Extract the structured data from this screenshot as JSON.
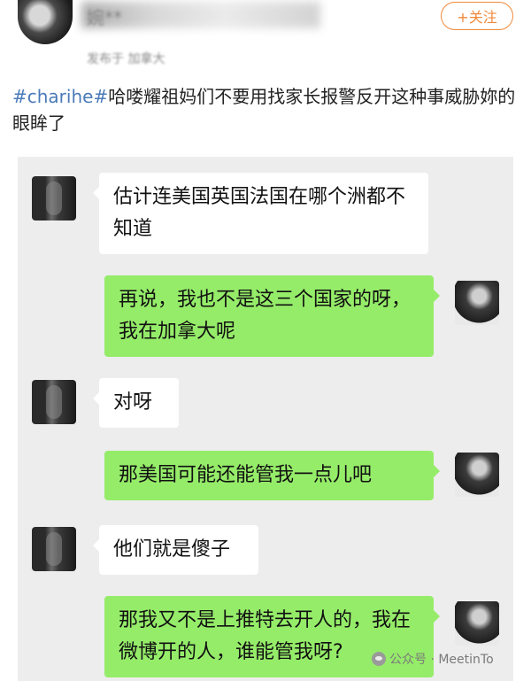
{
  "post": {
    "username": "婉**",
    "posted_in": "发布于 加拿大",
    "follow_label": "+关注",
    "hashtag": "#charihe#",
    "text": "哈喽耀祖妈们不要用找家长报警反开这种事威胁妳的眼眸了"
  },
  "messages": [
    {
      "side": "left",
      "text": "估计连美国英国法国在哪个洲都不知道"
    },
    {
      "side": "right",
      "text": "再说，我也不是这三个国家的呀，我在加拿大呢"
    },
    {
      "side": "left",
      "text": "对呀"
    },
    {
      "side": "right",
      "text": "那美国可能还能管我一点儿吧"
    },
    {
      "side": "left",
      "text": "他们就是傻子"
    },
    {
      "side": "right",
      "text": "那我又不是上推特去开人的，我在微博开的人，谁能管我呀?"
    }
  ],
  "watermark": {
    "text": "公众号 · MeetinTo"
  },
  "colors": {
    "bubble_right": "#95ec69",
    "bubble_left": "#ffffff",
    "follow_accent": "#f08a3c",
    "hashtag": "#4a7ab8",
    "chat_bg": "#ededed"
  }
}
